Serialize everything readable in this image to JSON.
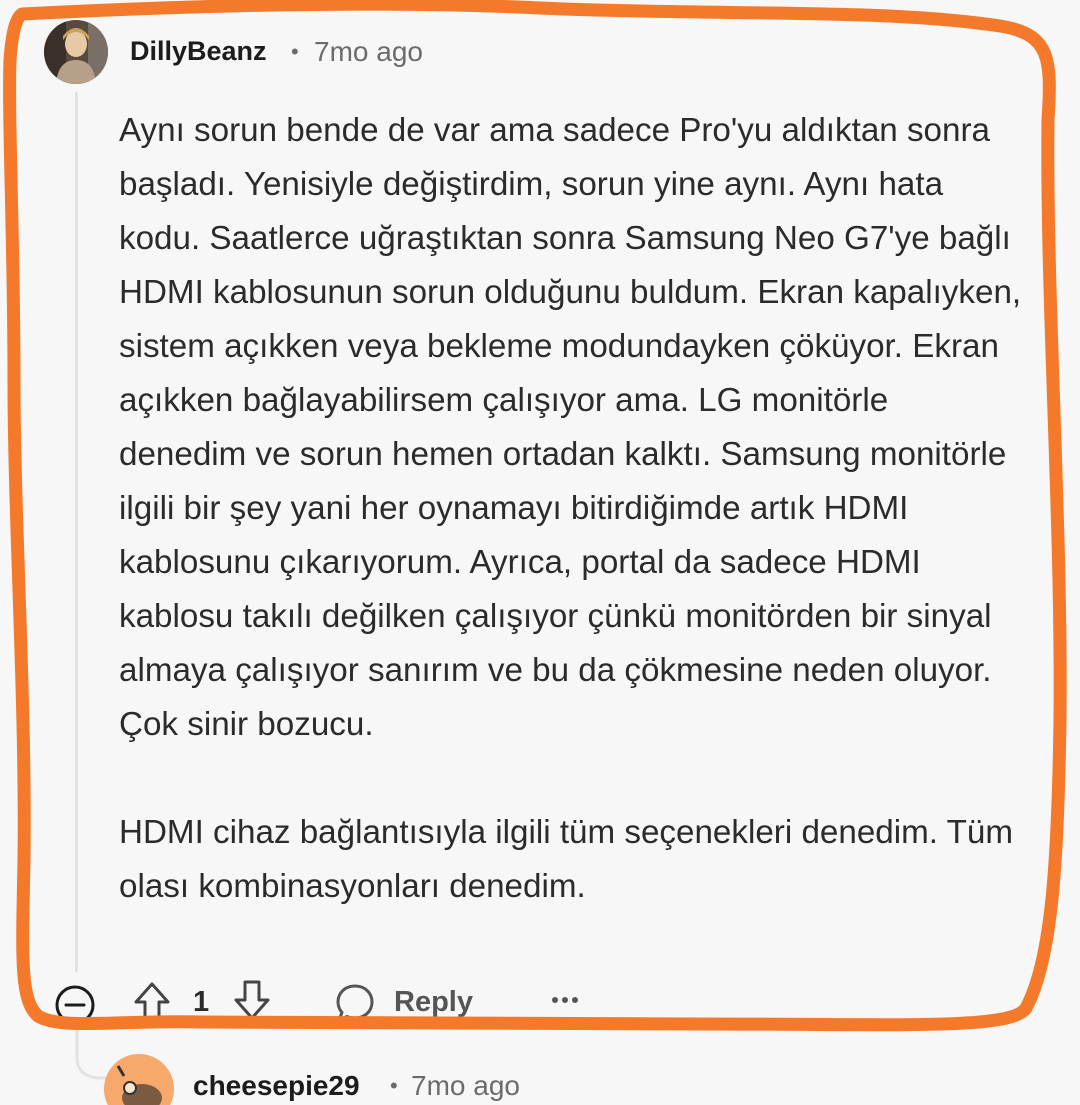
{
  "comment": {
    "username": "DillyBeanz",
    "separator": "•",
    "time": "7mo ago",
    "paragraphs": [
      "Aynı sorun bende de var ama sadece Pro'yu aldıktan sonra başladı. Yenisiyle değiştirdim, sorun yine aynı. Aynı hata kodu. Saatlerce uğraştıktan sonra Samsung Neo G7'ye bağlı HDMI kablosunun sorun olduğunu buldum. Ekran kapalıyken, sistem açıkken veya bekleme modundayken çöküyor. Ekran açıkken bağlayabilirsem çalışıyor ama. LG monitörle denedim ve sorun hemen ortadan kalktı. Samsung monitörle ilgili bir şey yani her oynamayı bitirdiğimde artık HDMI kablosunu çıkarıyorum. Ayrıca, portal da sadece HDMI kablosu takılı değilken çalışıyor çünkü monitörden bir sinyal almaya çalışıyor sanırım ve bu da çökmesine neden oluyor. Çok sinir bozucu.",
      "HDMI cihaz bağlantısıyla ilgili tüm seçenekleri denedim. Tüm olası kombinasyonları denedim."
    ],
    "vote_count": "1",
    "reply_label": "Reply",
    "more_label": "•••"
  },
  "reply_comment": {
    "username": "cheesepie29",
    "separator": "•",
    "time": "7mo ago"
  },
  "icons": {
    "collapse": "collapse-minus-icon",
    "upvote": "upvote-arrow-icon",
    "downvote": "downvote-arrow-icon",
    "reply": "speech-bubble-icon",
    "more": "more-dots-icon"
  },
  "colors": {
    "highlight_stroke": "#f4792b",
    "reply_avatar_bg": "#f6a96b"
  }
}
